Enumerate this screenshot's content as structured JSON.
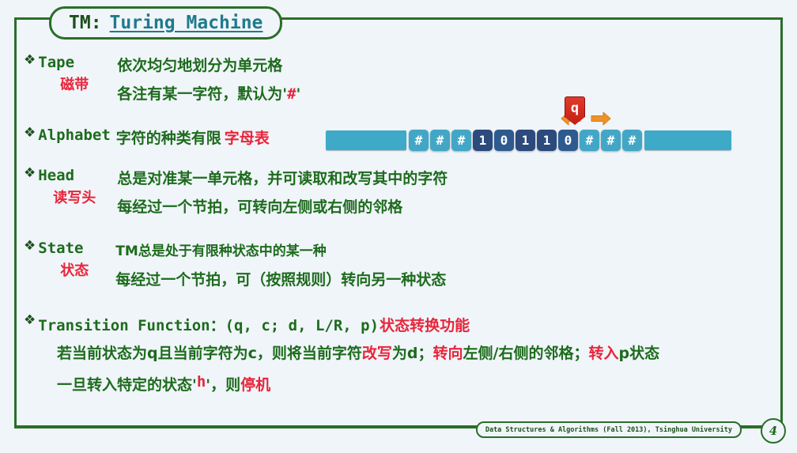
{
  "slide": {
    "title_prefix": "TM:",
    "title_name": "Turing Machine",
    "bullet_glyph": "❖",
    "background": "#f0f5f9",
    "frame_color": "#2a6e2a",
    "green_text": "#1d6b1d",
    "red_text": "#e8253b",
    "teal_title": "#1f7a8c"
  },
  "sections": {
    "tape": {
      "keyword": "Tape",
      "keyword_cn": "磁带",
      "line1": "依次均匀地划分为单元格",
      "line2_a": "各注有某一字符，默认为'",
      "line2_hash": "#",
      "line2_b": "'"
    },
    "alphabet": {
      "keyword": "Alphabet",
      "text_green": "字符的种类有限",
      "text_red": "字母表"
    },
    "head": {
      "keyword": "Head",
      "keyword_cn": "读写头",
      "line1": "总是对准某一单元格，并可读取和改写其中的字符",
      "line2": "每经过一个节拍，可转向左侧或右侧的邻格"
    },
    "state": {
      "keyword": "State",
      "keyword_cn": "状态",
      "line1": "TM总是处于有限种状态中的某一种",
      "line2": "每经过一个节拍，可（按照规则）转向另一种状态"
    },
    "transition": {
      "keyword": "Transition Function：(q, c; d, L/R, p)",
      "keyword_cn": "状态转换功能",
      "rule_1": "若当前状态为q且当前字符为c，则将当前字符",
      "rule_1_red_a": "改写",
      "rule_2": "为d；",
      "rule_2_red_b": "转向",
      "rule_3": "左侧/右侧的邻格；",
      "rule_3_red_c": "转入",
      "rule_4": "p状态",
      "halt_a": "一旦转入特定的状态'",
      "halt_h": "h",
      "halt_b": "'，则",
      "halt_red": "停机"
    }
  },
  "tape_cells": [
    {
      "label": "#",
      "kind": "blank"
    },
    {
      "label": "#",
      "kind": "blank"
    },
    {
      "label": "#",
      "kind": "blank"
    },
    {
      "label": "1",
      "kind": "one"
    },
    {
      "label": "0",
      "kind": "zero"
    },
    {
      "label": "1",
      "kind": "one"
    },
    {
      "label": "1",
      "kind": "one"
    },
    {
      "label": "0",
      "kind": "zero"
    },
    {
      "label": "#",
      "kind": "blank"
    },
    {
      "label": "#",
      "kind": "blank"
    },
    {
      "label": "#",
      "kind": "blank"
    }
  ],
  "head_marker": {
    "state_label": "q",
    "left_arrow": "left-arrow-icon",
    "right_arrow": "right-arrow-icon",
    "flag_color": "#c21f12",
    "arrow_color": "#f0922a"
  },
  "footer": {
    "credit": "Data Structures & Algorithms (Fall 2013), Tsinghua University",
    "page": "4"
  }
}
